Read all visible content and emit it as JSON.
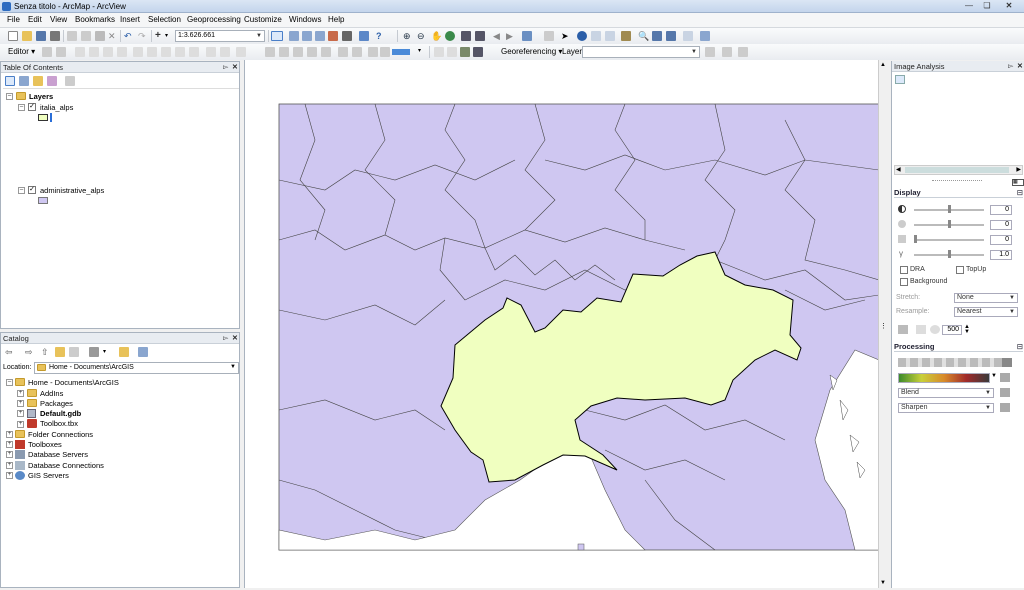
{
  "window": {
    "title": "Senza titolo - ArcMap - ArcView"
  },
  "menu": [
    "File",
    "Edit",
    "View",
    "Bookmarks",
    "Insert",
    "Selection",
    "Geoprocessing",
    "Customize",
    "Windows",
    "Help"
  ],
  "toolbar": {
    "scale": "1:3.626.661",
    "editor": "Editor",
    "georeferencing": "Georeferencing",
    "layer_label": "Layer:",
    "layer_value": ""
  },
  "toc": {
    "title": "Table Of Contents",
    "root": "Layers",
    "layers": [
      {
        "name": "italia_alps",
        "checked": true,
        "color": "#f0ffc0"
      },
      {
        "name": "administrative_alps",
        "checked": true,
        "color": "#cfc7f1"
      }
    ]
  },
  "catalog": {
    "title": "Catalog",
    "location_label": "Location:",
    "location_value": "Home - Documents\\ArcGIS",
    "home": "Home - Documents\\ArcGIS",
    "children": [
      "AddIns",
      "Packages",
      "Default.gdb",
      "Toolbox.tbx"
    ],
    "roots": [
      "Folder Connections",
      "Toolboxes",
      "Database Servers",
      "Database Connections",
      "GIS Servers"
    ]
  },
  "image_analysis": {
    "title": "Image Analysis",
    "display": {
      "title": "Display",
      "values": [
        "0",
        "0",
        "0",
        "1.0"
      ],
      "dra": "DRA",
      "topup": "TopUp",
      "background": "Background",
      "stretch_label": "Stretch:",
      "stretch_value": "None",
      "resample_label": "Resample:",
      "resample_value": "Nearest",
      "zoom_value": "500"
    },
    "processing": {
      "title": "Processing",
      "blend": "Blend",
      "sharpen": "Sharpen"
    }
  },
  "map": {
    "fill_admin": "#cfc7f1",
    "fill_italy": "#f0ffc0",
    "stroke": "#333333"
  }
}
